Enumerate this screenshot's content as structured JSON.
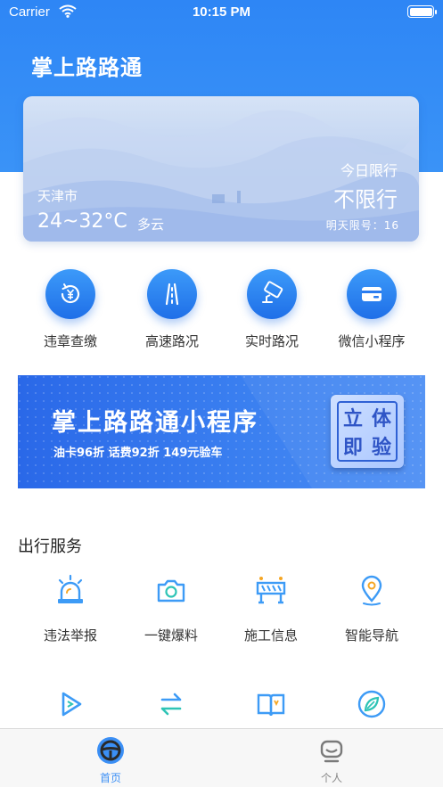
{
  "status_bar": {
    "carrier": "Carrier",
    "time": "10:15 PM"
  },
  "app": {
    "title": "掌上路路通"
  },
  "weather": {
    "city": "天津市",
    "temperature": "24~32°C",
    "condition": "多云",
    "limit_title": "今日限行",
    "limit_value": "不限行",
    "tomorrow_limit": "明天限号：16"
  },
  "quick_actions": [
    {
      "label": "违章查缴",
      "icon": "violation-yen-icon"
    },
    {
      "label": "高速路况",
      "icon": "highway-icon"
    },
    {
      "label": "实时路况",
      "icon": "camera-icon"
    },
    {
      "label": "微信小程序",
      "icon": "card-icon"
    }
  ],
  "banner": {
    "title": "掌上路路通小程序",
    "subtitle": "油卡96折  话费92折  149元验车",
    "badge_chars": [
      "立",
      "体",
      "即",
      "验"
    ]
  },
  "services": {
    "title": "出行服务",
    "items": [
      {
        "label": "违法举报",
        "icon": "siren-icon"
      },
      {
        "label": "一键爆料",
        "icon": "camera-icon"
      },
      {
        "label": "施工信息",
        "icon": "barrier-icon"
      },
      {
        "label": "智能导航",
        "icon": "location-pin-icon"
      }
    ],
    "row2_icons": [
      "play-icon",
      "swap-arrows-icon",
      "book-icon",
      "compass-leaf-icon"
    ]
  },
  "tabbar": {
    "tabs": [
      {
        "label": "首页",
        "icon": "steering-wheel-icon",
        "active": true
      },
      {
        "label": "个人",
        "icon": "profile-icon",
        "active": false
      }
    ]
  },
  "colors": {
    "primary": "#2e86f5",
    "accent_icon": "#3d9bf6",
    "tab_active": "#3b8ff5",
    "tab_inactive": "#888888"
  }
}
